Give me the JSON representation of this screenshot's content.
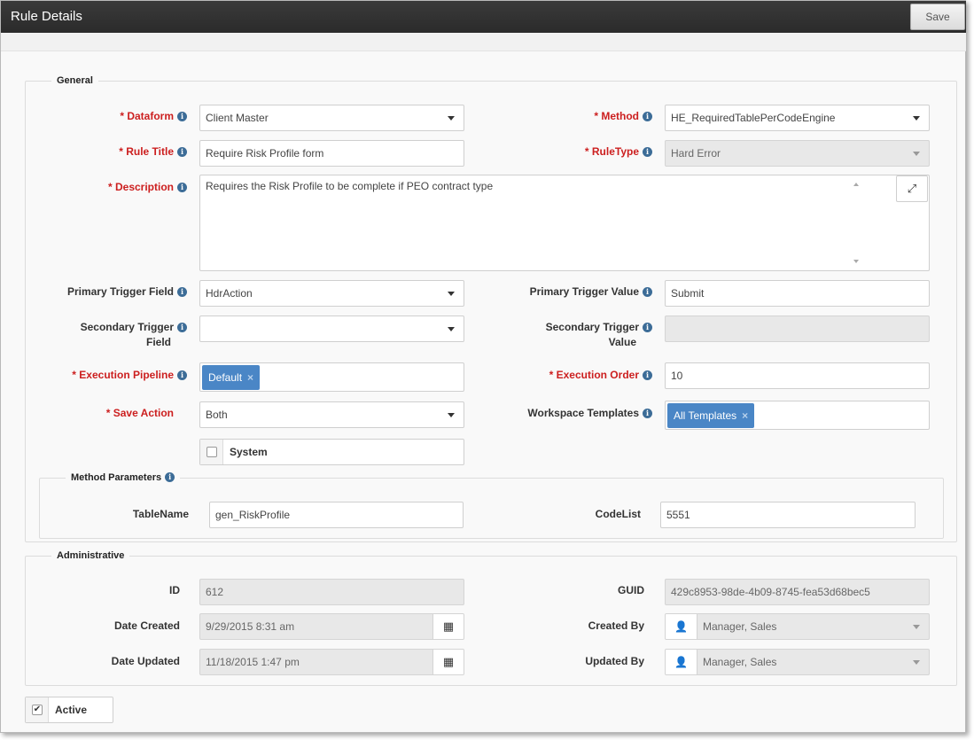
{
  "window": {
    "title": "Rule Details",
    "save_label": "Save"
  },
  "general": {
    "legend": "General",
    "dataform": {
      "label": "* Dataform",
      "value": "Client Master"
    },
    "method": {
      "label": "* Method",
      "value": "HE_RequiredTablePerCodeEngine"
    },
    "rule_title": {
      "label": "* Rule Title",
      "value": "Require Risk Profile form"
    },
    "rule_type": {
      "label": "* RuleType",
      "value": "Hard Error"
    },
    "description": {
      "label": "* Description",
      "value": "Requires the Risk Profile to be complete if PEO contract type"
    },
    "primary_trigger_field": {
      "label": "Primary Trigger Field",
      "value": "HdrAction"
    },
    "primary_trigger_value": {
      "label": "Primary Trigger Value",
      "value": "Submit"
    },
    "secondary_trigger_field": {
      "label_line1": "Secondary Trigger",
      "label_line2": "Field",
      "value": ""
    },
    "secondary_trigger_value": {
      "label_line1": "Secondary Trigger",
      "label_line2": "Value",
      "value": ""
    },
    "execution_pipeline": {
      "label": "* Execution Pipeline",
      "tag": "Default",
      "tag_remove": "×"
    },
    "execution_order": {
      "label": "* Execution Order",
      "value": "10"
    },
    "save_action": {
      "label": "* Save Action",
      "value": "Both"
    },
    "workspace_templates": {
      "label": "Workspace Templates",
      "tag": "All Templates",
      "tag_remove": "×"
    },
    "system": {
      "label": "System",
      "checked": false
    }
  },
  "method_parameters": {
    "legend": "Method Parameters",
    "table_name": {
      "label": "TableName",
      "value": "gen_RiskProfile"
    },
    "code_list": {
      "label": "CodeList",
      "value": "5551"
    }
  },
  "administrative": {
    "legend": "Administrative",
    "id": {
      "label": "ID",
      "value": "612"
    },
    "guid": {
      "label": "GUID",
      "value": "429c8953-98de-4b09-8745-fea53d68bec5"
    },
    "date_created": {
      "label": "Date Created",
      "value": "9/29/2015 8:31 am"
    },
    "created_by": {
      "label": "Created By",
      "value": "Manager, Sales"
    },
    "date_updated": {
      "label": "Date Updated",
      "value": "11/18/2015 1:47 pm"
    },
    "updated_by": {
      "label": "Updated By",
      "value": "Manager, Sales"
    }
  },
  "active": {
    "label": "Active",
    "checked": true
  },
  "icons": {
    "info": "info-icon",
    "calendar": "calendar-icon",
    "user": "user-icon",
    "expand": "expand-icon",
    "dropdown": "chevron-down-icon"
  }
}
